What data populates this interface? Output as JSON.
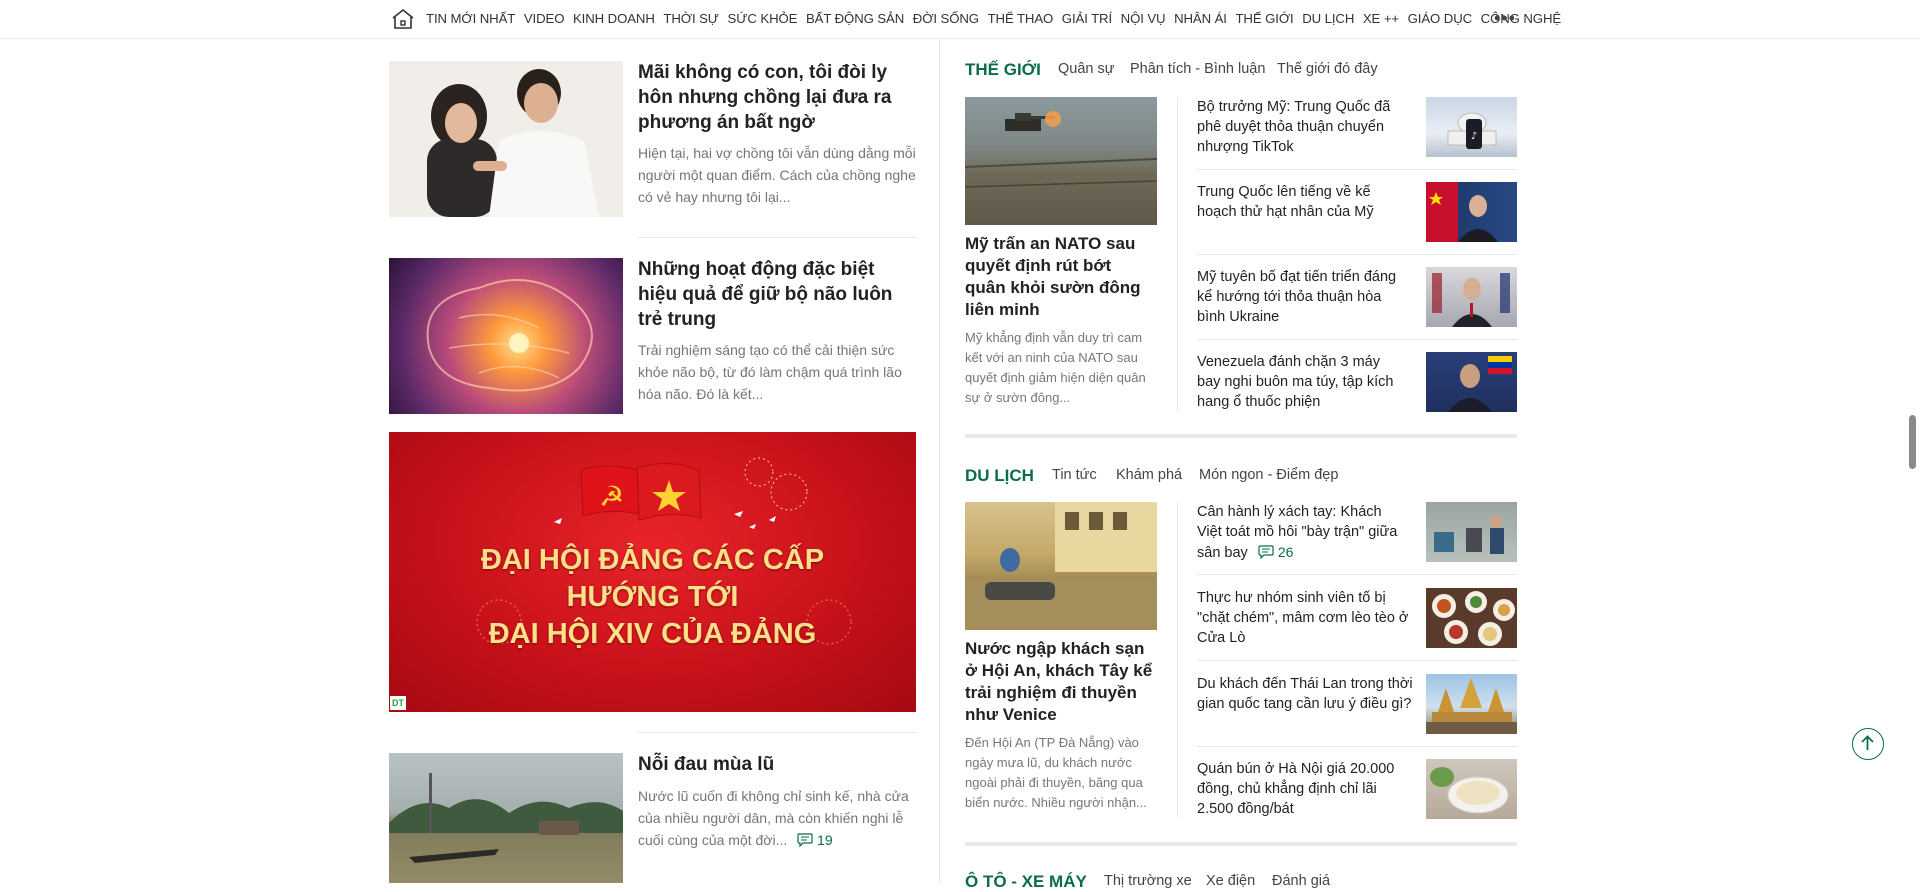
{
  "nav": {
    "items": [
      "TIN MỚI NHẤT",
      "VIDEO",
      "KINH DOANH",
      "THỜI SỰ",
      "SỨC KHỎE",
      "BẤT ĐỘNG SẢN",
      "ĐỜI SỐNG",
      "THỂ THAO",
      "GIẢI TRÍ",
      "NỘI VỤ",
      "NHÂN ÁI",
      "THẾ GIỚI",
      "DU LỊCH",
      "XE ++",
      "GIÁO DỤC",
      "CÔNG NGHỆ"
    ],
    "home_icon": "home-icon",
    "more_icon": "more-icon",
    "more_label": "•••"
  },
  "left": {
    "articles": [
      {
        "title": "Mãi không có con, tôi đòi ly hôn nhưng chồng lại đưa ra phương án bất ngờ",
        "summary": "Hiện tại, hai vợ chồng tôi vẫn dùng dằng mỗi người một quan điểm. Cách của chồng nghe có vẻ hay nhưng tôi lại..."
      },
      {
        "title": "Những hoạt động đặc biệt hiệu quả để giữ bộ não luôn trẻ trung",
        "summary": "Trải nghiệm sáng tạo có thể cải thiện sức khỏe não bộ, từ đó làm chậm quá trình lão hóa não. Đó là kết..."
      },
      {
        "title": "Nỗi đau mùa lũ",
        "summary": "Nước lũ cuốn đi không chỉ sinh kế, nhà cửa của nhiều người dân, mà còn khiến nghi lễ cuối cùng của một đời...",
        "comments": "19"
      }
    ],
    "banner": {
      "line1": "ĐẠI HỘI ĐẢNG CÁC CẤP",
      "line2": "HƯỚNG TỚI",
      "line3": "ĐẠI HỘI XIV CỦA ĐẢNG",
      "badge": "DT",
      "red": "#d0121b"
    }
  },
  "the_gioi": {
    "title": "THẾ GIỚI",
    "subs": [
      "Quân sự",
      "Phân tích - Bình luận",
      "Thế giới đó đây"
    ],
    "featured": {
      "title": "Mỹ trấn an NATO sau quyết định rút bớt quân khỏi sườn đông liên minh",
      "summary": "Mỹ khẳng định vẫn duy trì cam kết với an ninh của NATO sau quyết định giảm hiện diện quân sự ở sườn đông..."
    },
    "items": [
      "Bộ trưởng Mỹ: Trung Quốc đã phê duyệt thỏa thuận chuyển nhượng TikTok",
      "Trung Quốc lên tiếng về kế hoạch thử hạt nhân của Mỹ",
      "Mỹ tuyên bố đạt tiến triển đáng kể hướng tới thỏa thuận hòa bình Ukraine",
      "Venezuela đánh chặn 3 máy bay nghi buôn ma túy, tập kích hang ổ thuốc phiện"
    ]
  },
  "du_lich": {
    "title": "DU LỊCH",
    "subs": [
      "Tin tức",
      "Khám phá",
      "Món ngon - Điểm đẹp"
    ],
    "featured": {
      "title": "Nước ngập khách sạn ở Hội An, khách Tây kể trải nghiệm đi thuyền như Venice",
      "summary": "Đến Hội An (TP Đà Nẵng) vào ngày mưa lũ, du khách nước ngoài phải đi thuyền, băng qua biển nước. Nhiều người nhận..."
    },
    "items": [
      {
        "title": "Cân hành lý xách tay: Khách Việt toát mồ hôi \"bày trận\" giữa sân bay",
        "comments": "26"
      },
      {
        "title": "Thực hư nhóm sinh viên tố bị \"chặt chém\", mâm cơm lèo tèo ở Cửa Lò"
      },
      {
        "title": "Du khách đến Thái Lan trong thời gian quốc tang cần lưu ý điều gì?"
      },
      {
        "title": "Quán bún ở Hà Nội giá 20.000 đồng, chủ khẳng định chỉ lãi 2.500 đồng/bát"
      }
    ]
  },
  "oto": {
    "title": "Ô TÔ - XE MÁY",
    "subs": [
      "Thị trường xe",
      "Xe điện",
      "Đánh giá"
    ]
  },
  "colors": {
    "accent": "#0b6b4e",
    "text": "#222222",
    "muted": "#757575"
  }
}
